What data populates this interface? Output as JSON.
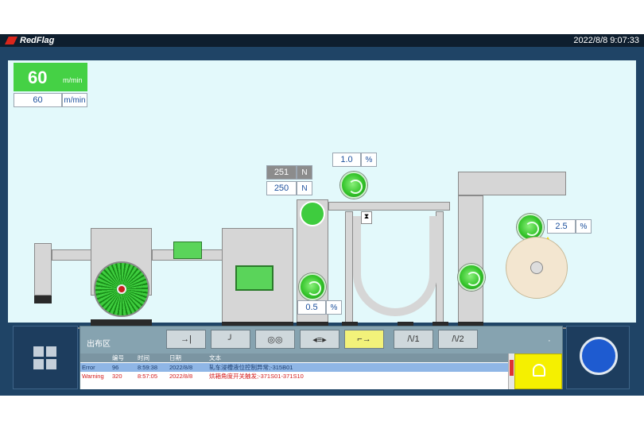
{
  "header": {
    "brand": "RedFlag",
    "datetime": "2022/8/8 9:07:33"
  },
  "speed": {
    "value": "60",
    "unit": "m/min",
    "setpoint": "60",
    "setpoint_unit": "m/min"
  },
  "tension": {
    "actual": "251",
    "setpoint": "250",
    "unit": "N"
  },
  "dancer_top": {
    "value": "1.0",
    "unit": "%"
  },
  "dancer_right": {
    "value": "2.5",
    "unit": "%"
  },
  "dancer_mid": {
    "value": "0.5",
    "unit": "%"
  },
  "colors": {
    "accent": "#33cc33",
    "header": "#0e1e2e",
    "panel": "#1f4466",
    "canvas": "#e3f9fb",
    "warning": "#f5d400"
  },
  "control": {
    "zone_label": "出布区",
    "buttons": [
      "→|",
      "╯",
      "◎◎",
      "◂≡▸",
      "⌐→",
      "/\\/1",
      "/\\/2"
    ],
    "dot": "·"
  },
  "alarm": {
    "headers": {
      "id": "编号",
      "time": "时间",
      "date": "日期",
      "text": "文本"
    },
    "rows": [
      {
        "type": "Error",
        "id": "96",
        "time": "8:59:38",
        "date": "2022/8/8",
        "text": "轧车浸槽液位控制异常;-315B01"
      },
      {
        "type": "Warning",
        "id": "320",
        "time": "8:57:05",
        "date": "2022/8/8",
        "text": "烘箱角度开关触发;-371S01-371S10"
      }
    ]
  }
}
